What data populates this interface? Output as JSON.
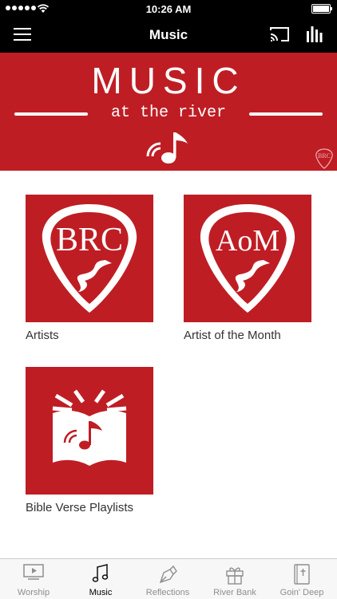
{
  "status_bar": {
    "time": "10:26 AM"
  },
  "nav": {
    "title": "Music"
  },
  "banner": {
    "title": "MUSIC",
    "subtitle": "at the river",
    "corner_logo": "BRC"
  },
  "tiles": [
    {
      "caption": "Artists",
      "icon": "guitar-pick-brc",
      "art_text": "BRC"
    },
    {
      "caption": "Artist of the Month",
      "icon": "guitar-pick-aom",
      "art_text": "AoM"
    },
    {
      "caption": "Bible Verse Playlists",
      "icon": "book-music-note"
    }
  ],
  "tab_bar": {
    "tabs": [
      {
        "label": "Worship",
        "icon": "tv-play-icon"
      },
      {
        "label": "Music",
        "icon": "music-note-icon",
        "active": true
      },
      {
        "label": "Reflections",
        "icon": "pen-nib-icon"
      },
      {
        "label": "River Bank",
        "icon": "gift-icon"
      },
      {
        "label": "Goin' Deep",
        "icon": "bible-icon"
      }
    ]
  },
  "colors": {
    "brand_red": "#bf1d24",
    "nav_black": "#000000",
    "tab_inactive": "#8e8e8e"
  }
}
